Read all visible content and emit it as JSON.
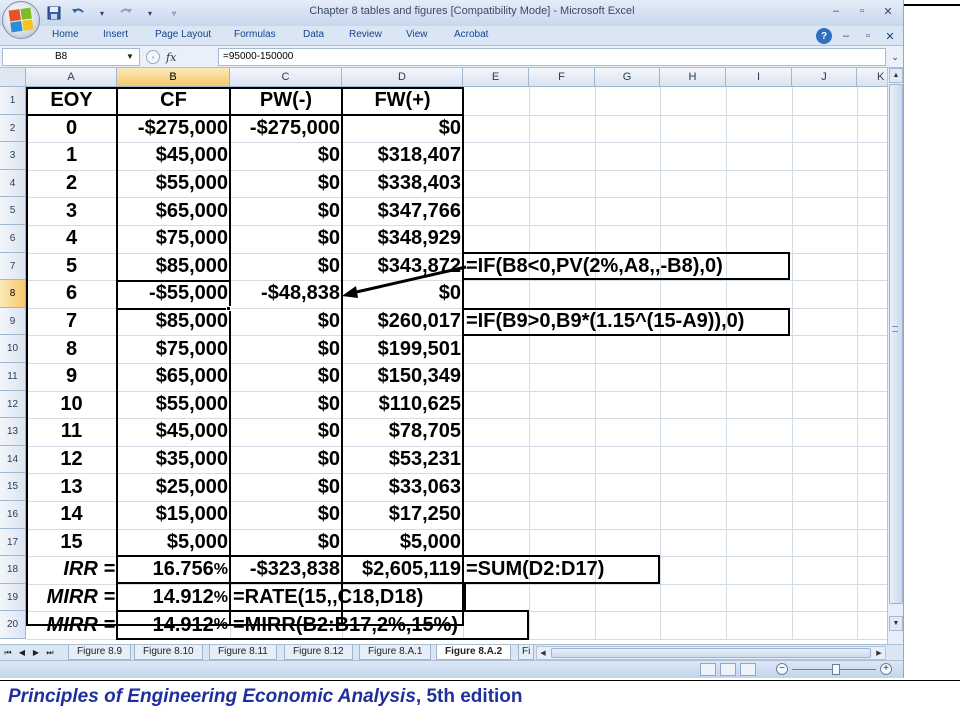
{
  "window": {
    "title": "Chapter 8 tables and figures  [Compatibility Mode] - Microsoft Excel",
    "controls": [
      "–",
      "▫",
      "✕"
    ]
  },
  "qat": {
    "save_icon": "save-icon",
    "undo_icon": "undo-icon",
    "redo_icon": "redo-icon"
  },
  "ribbon": {
    "tabs": [
      "Home",
      "Insert",
      "Page Layout",
      "Formulas",
      "Data",
      "Review",
      "View",
      "Acrobat"
    ],
    "help": "?",
    "minimize": "–",
    "restore": "▫",
    "close": "✕"
  },
  "formula_bar": {
    "name_box": "B8",
    "fx": "fx",
    "formula": "=95000-150000"
  },
  "sheet": {
    "columns": [
      "A",
      "B",
      "C",
      "D",
      "E",
      "F",
      "G",
      "H",
      "I",
      "J",
      "K"
    ],
    "selected_col": "B",
    "selected_row": 8,
    "rows": [
      "1",
      "2",
      "3",
      "4",
      "5",
      "6",
      "7",
      "8",
      "9",
      "10",
      "11",
      "12",
      "13",
      "14",
      "15",
      "16",
      "17",
      "18",
      "19",
      "20"
    ],
    "headers": {
      "eoy": "EOY",
      "cf": "CF",
      "pw": "PW(-)",
      "fw": "FW(+)"
    },
    "data": [
      {
        "eoy": "0",
        "cf": "-$275,000",
        "pw": "-$275,000",
        "fw": "$0"
      },
      {
        "eoy": "1",
        "cf": "$45,000",
        "pw": "$0",
        "fw": "$318,407"
      },
      {
        "eoy": "2",
        "cf": "$55,000",
        "pw": "$0",
        "fw": "$338,403"
      },
      {
        "eoy": "3",
        "cf": "$65,000",
        "pw": "$0",
        "fw": "$347,766"
      },
      {
        "eoy": "4",
        "cf": "$75,000",
        "pw": "$0",
        "fw": "$348,929"
      },
      {
        "eoy": "5",
        "cf": "$85,000",
        "pw": "$0",
        "fw": "$343,872"
      },
      {
        "eoy": "6",
        "cf": "-$55,000",
        "pw": "-$48,838",
        "fw": "$0"
      },
      {
        "eoy": "7",
        "cf": "$85,000",
        "pw": "$0",
        "fw": "$260,017"
      },
      {
        "eoy": "8",
        "cf": "$75,000",
        "pw": "$0",
        "fw": "$199,501"
      },
      {
        "eoy": "9",
        "cf": "$65,000",
        "pw": "$0",
        "fw": "$150,349"
      },
      {
        "eoy": "10",
        "cf": "$55,000",
        "pw": "$0",
        "fw": "$110,625"
      },
      {
        "eoy": "11",
        "cf": "$45,000",
        "pw": "$0",
        "fw": "$78,705"
      },
      {
        "eoy": "12",
        "cf": "$35,000",
        "pw": "$0",
        "fw": "$53,231"
      },
      {
        "eoy": "13",
        "cf": "$25,000",
        "pw": "$0",
        "fw": "$33,063"
      },
      {
        "eoy": "14",
        "cf": "$15,000",
        "pw": "$0",
        "fw": "$17,250"
      },
      {
        "eoy": "15",
        "cf": "$5,000",
        "pw": "$0",
        "fw": "$5,000"
      }
    ],
    "summary": {
      "irr_label": "IRR =",
      "irr_num": "16.756",
      "irr_pct": "%",
      "irr_pw": "-$323,838",
      "irr_fw": "$2,605,119",
      "irr_formula": "=SUM(D2:D17)",
      "mirr1_label": "MIRR =",
      "mirr1_num": "14.912",
      "mirr1_pct": "%",
      "mirr1_formula": "=RATE(15,,C18,D18)",
      "mirr2_label": "MIRR =",
      "mirr2_num": "14.912",
      "mirr2_pct": "%",
      "mirr2_formula": "=MIRR(B2:B17,2%,15%)"
    },
    "annotations": {
      "pv_formula": "=IF(B8<0,PV(2%,A8,,-B8),0)",
      "fw_formula": "=IF(B9>0,B9*(1.15^(15-A9)),0)"
    }
  },
  "sheet_tabs": {
    "items": [
      "Figure 8.9",
      "Figure 8.10",
      "Figure 8.11",
      "Figure 8.12",
      "Figure 8.A.1",
      "Figure 8.A.2",
      "Fi"
    ],
    "active": "Figure 8.A.2",
    "nav": [
      "⏮",
      "◀",
      "▶",
      "⏭"
    ]
  },
  "caption": {
    "italic_part": "Principles of Engineering Economic Analysis",
    "rest": ", 5th edition"
  },
  "colors": {
    "caption": "#1f2f9e",
    "selection": "#f5c96c",
    "chrome": "#dfe8f5"
  }
}
